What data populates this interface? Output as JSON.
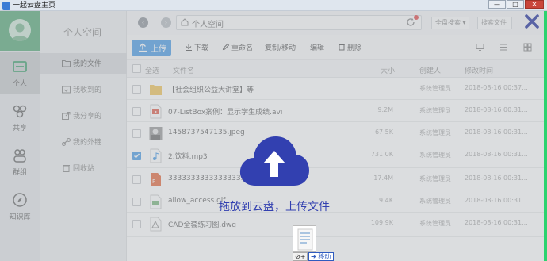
{
  "window": {
    "title": "一起云盘主页",
    "minimize": "—",
    "maximize": "□",
    "close": "✕"
  },
  "nav": {
    "items": [
      {
        "label": "个人",
        "icon": "drive-icon"
      },
      {
        "label": "共享",
        "icon": "share-icon"
      },
      {
        "label": "群组",
        "icon": "group-icon"
      },
      {
        "label": "知识库",
        "icon": "compass-icon"
      }
    ]
  },
  "sidebar": {
    "title": "个人空间",
    "items": [
      {
        "label": "我的文件"
      },
      {
        "label": "我收到的"
      },
      {
        "label": "我分享的"
      },
      {
        "label": "我的外链"
      },
      {
        "label": "回收站"
      }
    ]
  },
  "address": {
    "path": "个人空间"
  },
  "scope_select": {
    "value": "全盘搜索"
  },
  "search": {
    "placeholder": "搜索文件"
  },
  "toolbar": {
    "upload": "上传",
    "download": "下载",
    "rename": "重命名",
    "copymove": "复制/移动",
    "edit": "编辑",
    "delete": "删除"
  },
  "table": {
    "headers": {
      "all": "全选",
      "name": "文件名",
      "size": "大小",
      "creator": "创建人",
      "time": "修改时间"
    },
    "rows": [
      {
        "name": "【社会组织公益大讲堂】等",
        "size": "",
        "creator": "系统管理员",
        "time": "2018-08-16 00:37...",
        "type": "folder",
        "checked": false
      },
      {
        "name": "07-ListBox案例：显示学生成绩.avi",
        "size": "9.2M",
        "creator": "系统管理员",
        "time": "2018-08-16 00:31...",
        "type": "avi",
        "checked": false
      },
      {
        "name": "1458737547135.jpeg",
        "size": "67.5K",
        "creator": "系统管理员",
        "time": "2018-08-16 00:31...",
        "type": "jpeg",
        "checked": false
      },
      {
        "name": "2.饮料.mp3",
        "size": "731.0K",
        "creator": "系统管理员",
        "time": "2018-08-16 00:31...",
        "type": "mp3",
        "checked": true
      },
      {
        "name": "3333333333333333.ppt",
        "size": "17.4M",
        "creator": "系统管理员",
        "time": "2018-08-16 00:31...",
        "type": "ppt",
        "checked": false
      },
      {
        "name": "allow_access.gif",
        "size": "9.4K",
        "creator": "系统管理员",
        "time": "2018-08-16 00:31...",
        "type": "gif",
        "checked": false
      },
      {
        "name": "CAD全套练习图.dwg",
        "size": "109.9K",
        "creator": "系统管理员",
        "time": "2018-08-16 00:31...",
        "type": "dwg",
        "checked": false
      }
    ]
  },
  "drop_overlay": {
    "message": "拖放到云盘，上传文件",
    "icon": "cloud-upload-icon"
  },
  "drag": {
    "cursor_label": "⊘+",
    "tooltip": "移动"
  },
  "colors": {
    "accent": "#4a9be5",
    "overlay_icon": "#3240b0",
    "avatar_bg": "#58a979"
  }
}
